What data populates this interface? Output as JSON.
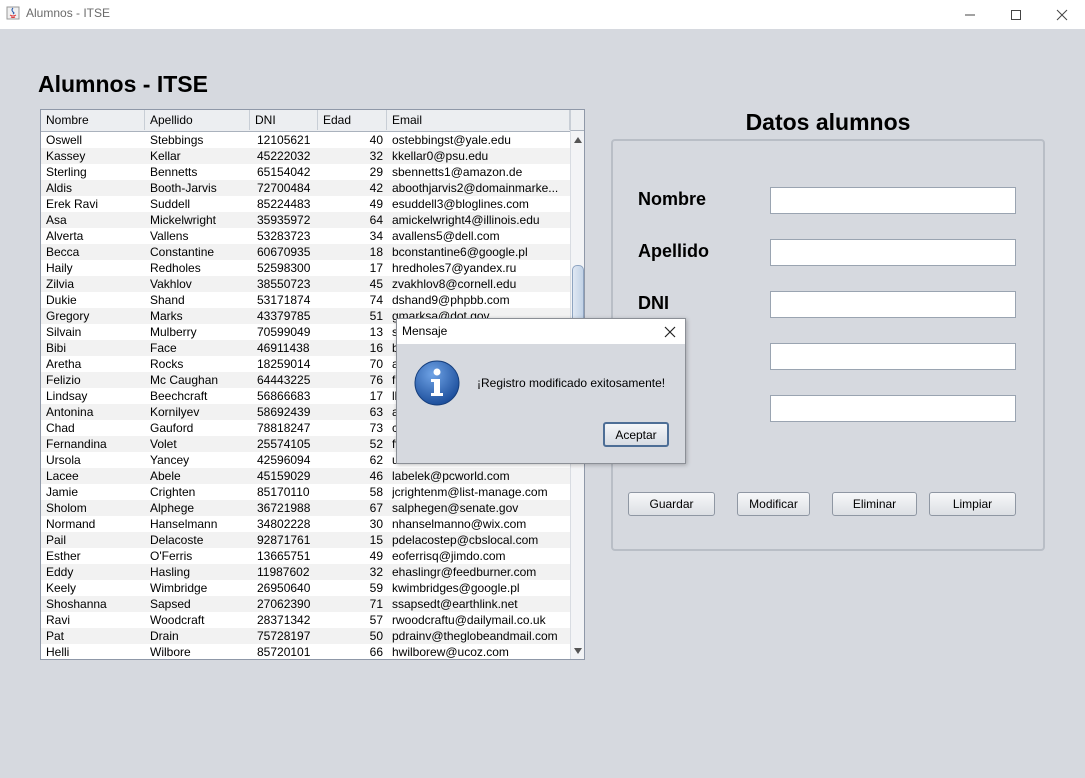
{
  "window": {
    "title": "Alumnos - ITSE",
    "icon": "java-icon"
  },
  "heading": "Alumnos - ITSE",
  "table": {
    "columns": [
      "Nombre",
      "Apellido",
      "DNI",
      "Edad",
      "Email"
    ],
    "rows": [
      [
        "Oswell",
        "Stebbings",
        "12105621",
        "40",
        "ostebbingst@yale.edu"
      ],
      [
        "Kassey",
        "Kellar",
        "45222032",
        "32",
        "kkellar0@psu.edu"
      ],
      [
        "Sterling",
        "Bennetts",
        "65154042",
        "29",
        "sbennetts1@amazon.de"
      ],
      [
        "Aldis",
        "Booth-Jarvis",
        "72700484",
        "42",
        "aboothjarvis2@domainmarke..."
      ],
      [
        "Erek Ravi",
        "Suddell",
        "85224483",
        "49",
        "esuddell3@bloglines.com"
      ],
      [
        "Asa",
        "Mickelwright",
        "35935972",
        "64",
        "amickelwright4@illinois.edu"
      ],
      [
        "Alverta",
        "Vallens",
        "53283723",
        "34",
        "avallens5@dell.com"
      ],
      [
        "Becca",
        "Constantine",
        "60670935",
        "18",
        "bconstantine6@google.pl"
      ],
      [
        "Haily",
        "Redholes",
        "52598300",
        "17",
        "hredholes7@yandex.ru"
      ],
      [
        "Zilvia",
        "Vakhlov",
        "38550723",
        "45",
        "zvakhlov8@cornell.edu"
      ],
      [
        "Dukie",
        "Shand",
        "53171874",
        "74",
        "dshand9@phpbb.com"
      ],
      [
        "Gregory",
        "Marks",
        "43379785",
        "51",
        "gmarksa@dot.gov"
      ],
      [
        "Silvain",
        "Mulberry",
        "70599049",
        "13",
        "s"
      ],
      [
        "Bibi",
        "Face",
        "46911438",
        "16",
        "b"
      ],
      [
        "Aretha",
        "Rocks",
        "18259014",
        "70",
        "a"
      ],
      [
        "Felizio",
        "Mc Caughan",
        "64443225",
        "76",
        "fi"
      ],
      [
        "Lindsay",
        "Beechcraft",
        "56866683",
        "17",
        "ll"
      ],
      [
        "Antonina",
        "Kornilyev",
        "58692439",
        "63",
        "a"
      ],
      [
        "Chad",
        "Gauford",
        "78818247",
        "73",
        "c"
      ],
      [
        "Fernandina",
        "Volet",
        "25574105",
        "52",
        "fv"
      ],
      [
        "Ursola",
        "Yancey",
        "42596094",
        "62",
        "u"
      ],
      [
        "Lacee",
        "Abele",
        "45159029",
        "46",
        "labelek@pcworld.com"
      ],
      [
        "Jamie",
        "Crighten",
        "85170110",
        "58",
        "jcrightenm@list-manage.com"
      ],
      [
        "Sholom",
        "Alphege",
        "36721988",
        "67",
        "salphegen@senate.gov"
      ],
      [
        "Normand",
        "Hanselmann",
        "34802228",
        "30",
        "nhanselmanno@wix.com"
      ],
      [
        "Pail",
        "Delacoste",
        "92871761",
        "15",
        "pdelacostep@cbslocal.com"
      ],
      [
        "Esther",
        "O'Ferris",
        "13665751",
        "49",
        "eoferrisq@jimdo.com"
      ],
      [
        "Eddy",
        "Hasling",
        "11987602",
        "32",
        "ehaslingr@feedburner.com"
      ],
      [
        "Keely",
        "Wimbridge",
        "26950640",
        "59",
        "kwimbridges@google.pl"
      ],
      [
        "Shoshanna",
        "Sapsed",
        "27062390",
        "71",
        "ssapsedt@earthlink.net"
      ],
      [
        "Ravi",
        "Woodcraft",
        "28371342",
        "57",
        "rwoodcraftu@dailymail.co.uk"
      ],
      [
        "Pat",
        "Drain",
        "75728197",
        "50",
        "pdrainv@theglobeandmail.com"
      ],
      [
        "Helli",
        "Wilbore",
        "85720101",
        "66",
        "hwilborew@ucoz.com"
      ]
    ]
  },
  "panel": {
    "title": "Datos alumnos",
    "fields": [
      {
        "label": "Nombre",
        "value": ""
      },
      {
        "label": "Apellido",
        "value": ""
      },
      {
        "label": "DNI",
        "value": ""
      },
      {
        "label": "",
        "value": ""
      },
      {
        "label": "",
        "value": ""
      }
    ],
    "buttons": {
      "save": "Guardar",
      "modify": "Modificar",
      "delete": "Eliminar",
      "clear": "Limpiar"
    }
  },
  "dialog": {
    "title": "Mensaje",
    "message": "¡Registro modificado exitosamente!",
    "ok_label": "Aceptar",
    "icon": "info-icon"
  },
  "colors": {
    "background": "#d6d9df",
    "info_icon": "#2b5fa8",
    "dialog_default_border": "#4d6e96"
  }
}
